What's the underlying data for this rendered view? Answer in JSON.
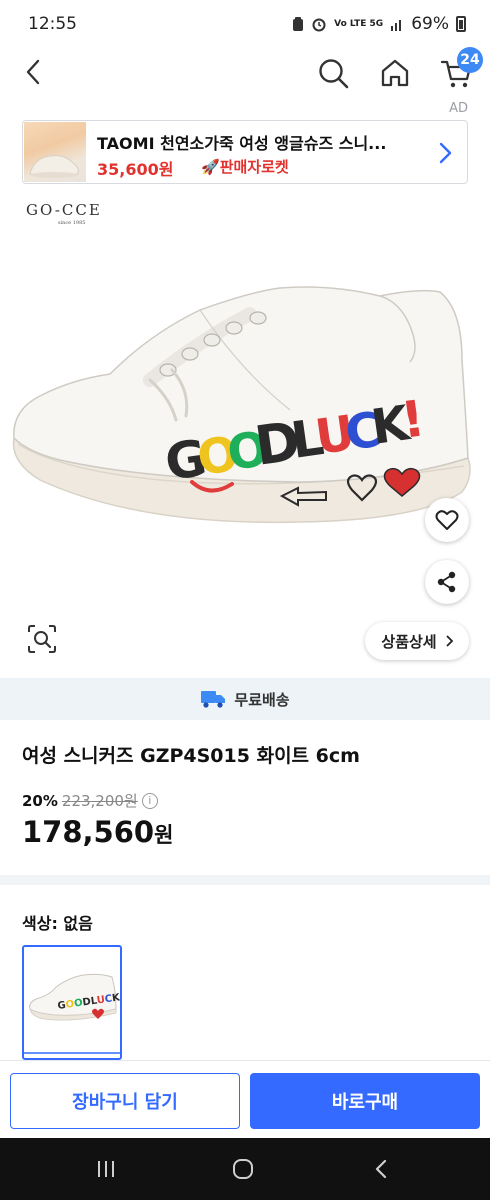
{
  "status_bar": {
    "time": "12:55",
    "network": "Vo LTE 5G",
    "battery": "69%"
  },
  "header": {
    "cart_count": "24"
  },
  "ad": {
    "label": "AD",
    "title": "TAOMI 천연소가죽 여성 앵글슈즈 스니...",
    "price": "35,600원",
    "badge": "판매자로켓"
  },
  "brand": {
    "name": "GO-CCE",
    "tagline": "since 1985"
  },
  "image_overlay": {
    "detail_button": "상품상세"
  },
  "shipping": {
    "label": "무료배송"
  },
  "product": {
    "name": "여성 스니커즈 GZP4S015 화이트 6cm",
    "discount": "20%",
    "original_price": "223,200원",
    "sale_price": "178,560",
    "currency": "원"
  },
  "option": {
    "label": "색상: 없음"
  },
  "bottom_bar": {
    "add_to_cart": "장바구니 담기",
    "buy_now": "바로구매"
  },
  "colors": {
    "primary": "#346aff",
    "badge": "#3d8af5",
    "rocket_red": "#e1322e",
    "shipping_bg": "#eef3f8"
  }
}
